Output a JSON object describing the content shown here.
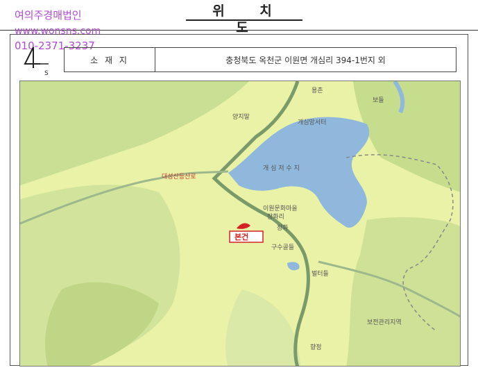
{
  "header": {
    "title": "위 치 도"
  },
  "watermark": {
    "company": "여의주경매법인",
    "website": "www.wonsns.com",
    "phone": "010-2371-3237"
  },
  "compass": {
    "letter": "S"
  },
  "address": {
    "label": "소 재 지",
    "value": "충청북도 옥천군 이원면 개심리 394-1번지 외"
  },
  "map": {
    "labels": {
      "village_top": "용촌",
      "village_right": "보들",
      "village_left": "양지말",
      "park": "개심망서터",
      "reservoir": "개 심 저 수 지",
      "road": "대성산등산로",
      "village_center": "이원문화마을",
      "village_center2": "장화리",
      "village_center3": "장화",
      "village_south": "구수골들",
      "village_east": "벌터들",
      "management": "보전관리지역",
      "village_bottom": "향정"
    },
    "marker_label": "본건",
    "colors": {
      "land": "#e9f2a6",
      "forest": "#c6dd8d",
      "water": "#8fb8dc",
      "road": "#7b9a6a",
      "marker": "#d22222"
    }
  }
}
